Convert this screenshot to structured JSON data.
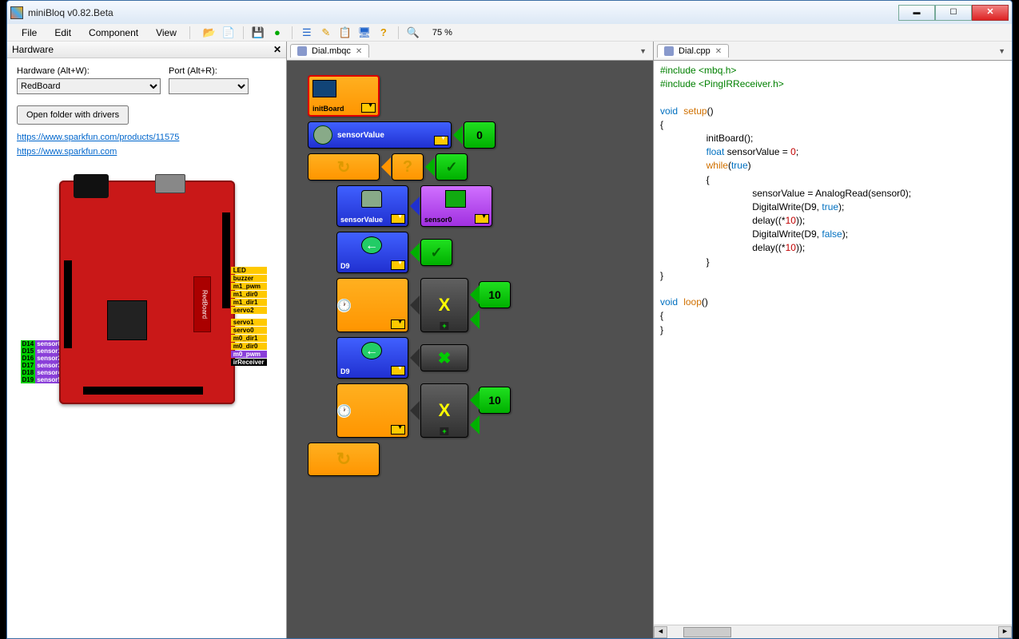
{
  "window": {
    "title": "miniBloq v0.82.Beta"
  },
  "menu": {
    "file": "File",
    "edit": "Edit",
    "component": "Component",
    "view": "View"
  },
  "toolbar": {
    "zoom": "75 %"
  },
  "hardware": {
    "panel_title": "Hardware",
    "hw_label": "Hardware (Alt+W):",
    "port_label": "Port (Alt+R):",
    "hw_value": "RedBoard",
    "port_value": "",
    "driver_btn": "Open folder with drivers",
    "link1": "https://www.sparkfun.com/products/11575",
    "link2": "https://www.sparkfun.com",
    "board_logo": "RedBoard",
    "pins_right": [
      "LED",
      "buzzer",
      "m1_pwm",
      "m1_dir0",
      "m1_dir1",
      "servo2"
    ],
    "pins_right2": [
      "servo1",
      "servo0",
      "m0_dir1",
      "m0_dir0",
      "m0_pwm"
    ],
    "pin_ir": "irReceiver",
    "pins_left": [
      {
        "d": "D14",
        "s": "sensor0"
      },
      {
        "d": "D15",
        "s": "sensor1"
      },
      {
        "d": "D16",
        "s": "sensor2"
      },
      {
        "d": "D17",
        "s": "sensor3"
      },
      {
        "d": "D18",
        "s": "sensor4"
      },
      {
        "d": "D19",
        "s": "sensor5"
      }
    ]
  },
  "center": {
    "tab": "Dial.mbqc",
    "init": "initBoard",
    "var_name": "sensorValue",
    "zero": "0",
    "sensor_var": "sensorValue",
    "sensor0": "sensor0",
    "d9_a": "D9",
    "d9_b": "D9",
    "ten_a": "10",
    "ten_b": "10",
    "mult": "X"
  },
  "code": {
    "tab": "Dial.cpp",
    "inc1": "#include <mbq.h>",
    "inc2": "#include <PingIRReceiver.h>",
    "setup_kw": "void",
    "setup_fn": "setup",
    "setup_paren": "()",
    "lb": "{",
    "rb": "}",
    "l1": "initBoard();",
    "l2a": "float",
    "l2b": " sensorValue = ",
    "l2c": "0",
    "l2d": ";",
    "l3a": "while",
    "l3b": "(",
    "l3c": "true",
    "l3d": ")",
    "l4": "sensorValue = AnalogRead(sensor0);",
    "l5a": "DigitalWrite(D9, ",
    "l5b": "true",
    "l5c": ");",
    "l6a": "delay((*",
    "l6b": "10",
    "l6c": "));",
    "l7a": "DigitalWrite(D9, ",
    "l7b": "false",
    "l7c": ");",
    "l8a": "delay((*",
    "l8b": "10",
    "l8c": "));",
    "loop_kw": "void",
    "loop_fn": "loop",
    "loop_paren": "()"
  }
}
